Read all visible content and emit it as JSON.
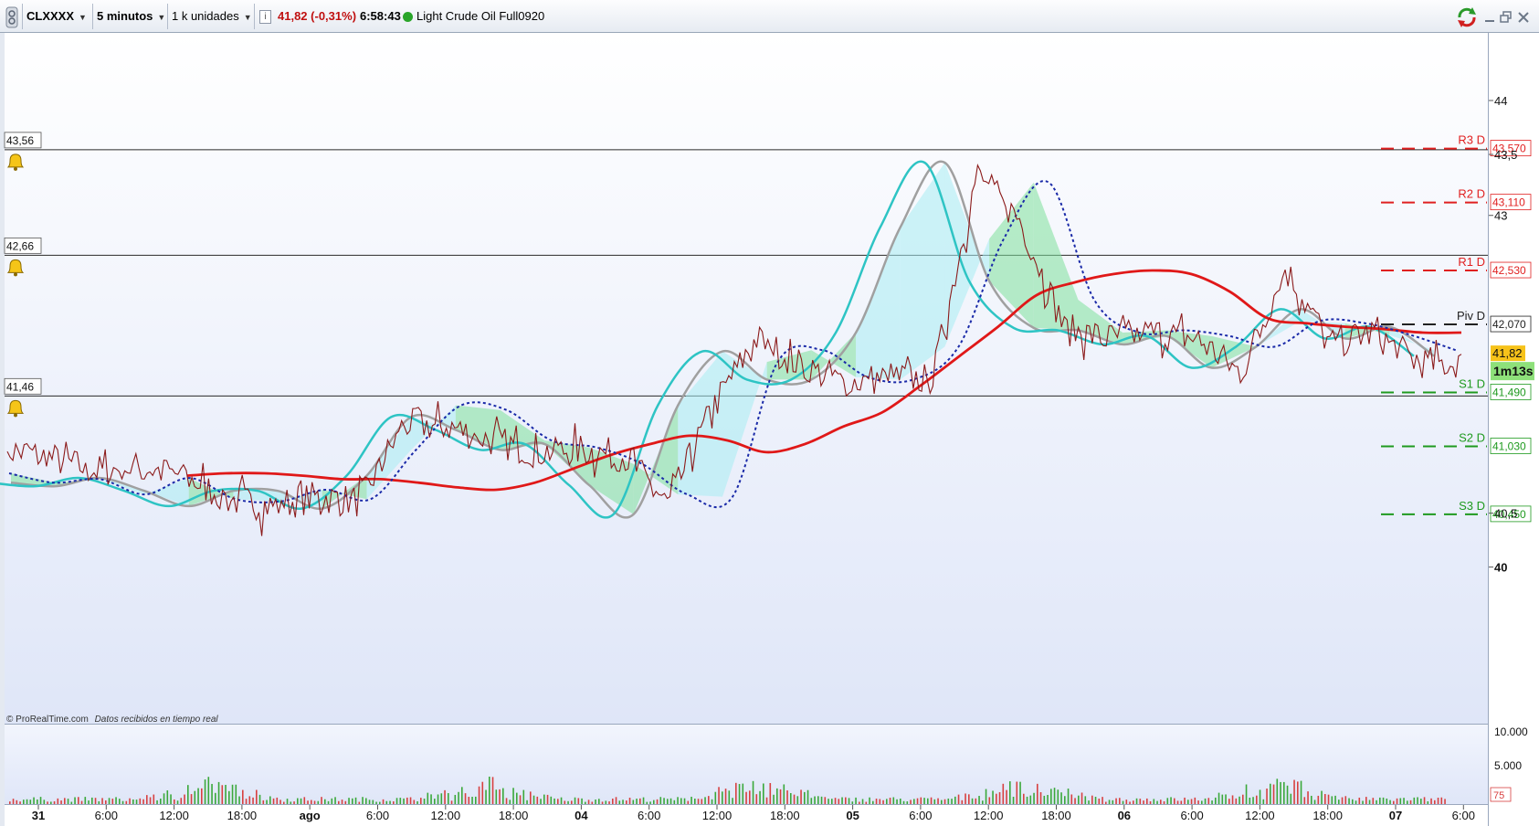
{
  "toolbar": {
    "symbol": "CLXXXX",
    "timeframe": "5 minutos",
    "units": "1 k unidades",
    "last_price": "41,82",
    "change": "(-0,31%)",
    "time": "6:58:43",
    "instrument_name": "Light Crude Oil Full0920",
    "status_color": "#2aa52a"
  },
  "footer": {
    "copyright": "© ProRealTime.com",
    "realtime_note": "Datos recibidos en tiempo real"
  },
  "alert_lines": [
    {
      "label": "43,56",
      "value": 43.56
    },
    {
      "label": "42,66",
      "value": 42.66
    },
    {
      "label": "41,46",
      "value": 41.46
    }
  ],
  "pivot_levels": [
    {
      "name": "R3 D",
      "value_label": "43,570",
      "value": 43.57,
      "color": "#e02020"
    },
    {
      "name": "R2 D",
      "value_label": "43,110",
      "value": 43.11,
      "color": "#e02020"
    },
    {
      "name": "R1 D",
      "value_label": "42,530",
      "value": 42.53,
      "color": "#e02020"
    },
    {
      "name": "Piv D",
      "value_label": "42,070",
      "value": 42.07,
      "color": "#222222"
    },
    {
      "name": "S1 D",
      "value_label": "41,490",
      "value": 41.49,
      "color": "#1f9a1f"
    },
    {
      "name": "S2 D",
      "value_label": "41,030",
      "value": 41.03,
      "color": "#1f9a1f"
    },
    {
      "name": "S3 D",
      "value_label": "40,450",
      "value": 40.45,
      "color": "#1f9a1f"
    }
  ],
  "price_axis": {
    "ticks": [
      {
        "label": "44",
        "value": 43.98
      },
      {
        "label": "43,5",
        "value": 43.52
      },
      {
        "label": "43",
        "value": 43.0
      },
      {
        "label": "40,5",
        "value": 40.46
      },
      {
        "label": "40",
        "value": 40.0
      }
    ],
    "current_price_label": "41,82",
    "countdown": "1m13s"
  },
  "volume_axis": {
    "ticks": [
      "10.000",
      "5.000"
    ],
    "current_volume": "75"
  },
  "time_axis": {
    "labels": [
      {
        "text": "31",
        "bold": true
      },
      {
        "text": "6:00",
        "bold": false
      },
      {
        "text": "12:00",
        "bold": false
      },
      {
        "text": "18:00",
        "bold": false
      },
      {
        "text": "ago",
        "bold": true
      },
      {
        "text": "6:00",
        "bold": false
      },
      {
        "text": "12:00",
        "bold": false
      },
      {
        "text": "18:00",
        "bold": false
      },
      {
        "text": "04",
        "bold": true
      },
      {
        "text": "6:00",
        "bold": false
      },
      {
        "text": "12:00",
        "bold": false
      },
      {
        "text": "18:00",
        "bold": false
      },
      {
        "text": "05",
        "bold": true
      },
      {
        "text": "6:00",
        "bold": false
      },
      {
        "text": "12:00",
        "bold": false
      },
      {
        "text": "18:00",
        "bold": false
      },
      {
        "text": "06",
        "bold": true
      },
      {
        "text": "6:00",
        "bold": false
      },
      {
        "text": "12:00",
        "bold": false
      },
      {
        "text": "18:00",
        "bold": false
      },
      {
        "text": "07",
        "bold": true
      },
      {
        "text": "6:00",
        "bold": false
      }
    ]
  },
  "colors": {
    "price_line": "#8b1a1a",
    "moving_avg_red": "#e01818",
    "moving_avg_cyan": "#2ec4c4",
    "moving_avg_gray": "#a0a0a0",
    "dotted_avg": "#1a2aa8",
    "cloud_green": "#7ee09a",
    "cloud_cyan": "#a8ecf2",
    "volume_green": "#3aa83a",
    "volume_red": "#d84040"
  },
  "chart_data": {
    "type": "line",
    "title": "Light Crude Oil Full0920",
    "x": [
      "31",
      "6:00",
      "12:00",
      "18:00",
      "ago",
      "6:00",
      "12:00",
      "18:00",
      "04",
      "6:00",
      "12:00",
      "18:00",
      "05",
      "6:00",
      "12:00",
      "18:00",
      "06",
      "6:00",
      "12:00",
      "18:00",
      "07",
      "6:00"
    ],
    "ylim": [
      39.55,
      44.05
    ],
    "series": [
      {
        "values": [
          41.0,
          40.93,
          40.82,
          40.85,
          40.78,
          40.58,
          40.52,
          40.6,
          40.56,
          41.22,
          41.2,
          41.08,
          40.98,
          41.0,
          40.95,
          40.53,
          41.35,
          41.95,
          41.72,
          41.57,
          41.62,
          41.6,
          43.35,
          42.95,
          42.03,
          41.95,
          42.0,
          41.95,
          41.65,
          42.55,
          41.9,
          42.0,
          41.75,
          41.72
        ]
      },
      {
        "values": [
          40.78,
          40.8,
          40.8,
          40.78,
          40.75,
          40.75,
          40.72,
          40.68,
          40.66,
          40.72,
          40.84,
          40.96,
          41.05,
          41.12,
          41.08,
          40.98,
          41.05,
          41.2,
          41.32,
          41.55,
          41.8,
          42.05,
          42.32,
          42.43,
          42.5,
          42.53,
          42.5,
          42.35,
          42.12,
          42.08,
          42.05,
          42.03,
          42.0,
          42.0
        ]
      },
      {
        "values": [
          40.72,
          40.69,
          40.76,
          40.65,
          40.52,
          40.65,
          40.65,
          40.5,
          40.78,
          41.28,
          41.17,
          41.0,
          41.05,
          40.7,
          40.45,
          41.38,
          41.84,
          41.6,
          41.6,
          42.0,
          42.9,
          43.45,
          42.44,
          42.04,
          42.02,
          41.9,
          41.97,
          41.7,
          41.88,
          42.2,
          41.95,
          42.05,
          41.8
        ]
      },
      {
        "values": [
          40.8,
          40.72,
          40.75,
          40.62,
          40.76,
          40.58,
          40.56,
          40.66,
          40.58,
          41.0,
          41.38,
          41.34,
          41.08,
          41.02,
          40.88,
          40.62,
          40.6,
          41.75,
          41.85,
          41.62,
          41.6,
          41.88,
          42.8,
          43.28,
          42.28,
          42.0,
          42.02,
          41.97,
          41.88,
          42.1,
          42.08,
          41.98,
          41.85
        ]
      }
    ],
    "note": "series 1 = price (dark red line), 2 = smoothed red MA, 3 = cyan/gray MA, 4 = dotted blue MA; volume subpanel on 0-10.000 scale"
  }
}
